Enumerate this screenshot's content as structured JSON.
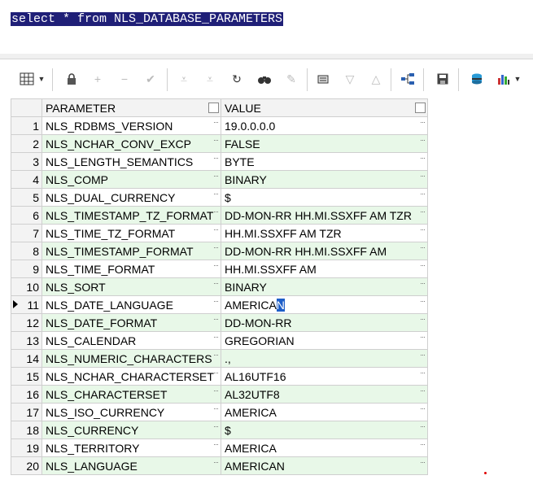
{
  "editor": {
    "sql_text": "select * from NLS_DATABASE_PARAMETERS"
  },
  "toolbar": {
    "icons": [
      "grid-view-icon",
      "dropdown-icon",
      "lock-icon",
      "add-icon",
      "remove-icon",
      "apply-icon",
      "first-icon",
      "last-icon",
      "refresh-icon",
      "search-icon",
      "clear-icon",
      "export-icon",
      "down-icon",
      "up-icon",
      "tree-icon",
      "save-icon",
      "db-icon",
      "chart-icon"
    ]
  },
  "grid": {
    "headers": [
      "PARAMETER",
      "VALUE"
    ],
    "rows": [
      {
        "n": "1",
        "param": "NLS_RDBMS_VERSION",
        "value": "19.0.0.0.0"
      },
      {
        "n": "2",
        "param": "NLS_NCHAR_CONV_EXCP",
        "value": "FALSE"
      },
      {
        "n": "3",
        "param": "NLS_LENGTH_SEMANTICS",
        "value": "BYTE"
      },
      {
        "n": "4",
        "param": "NLS_COMP",
        "value": "BINARY"
      },
      {
        "n": "5",
        "param": "NLS_DUAL_CURRENCY",
        "value": "$"
      },
      {
        "n": "6",
        "param": "NLS_TIMESTAMP_TZ_FORMAT",
        "value": "DD-MON-RR HH.MI.SSXFF AM TZR"
      },
      {
        "n": "7",
        "param": "NLS_TIME_TZ_FORMAT",
        "value": "HH.MI.SSXFF AM TZR"
      },
      {
        "n": "8",
        "param": "NLS_TIMESTAMP_FORMAT",
        "value": "DD-MON-RR HH.MI.SSXFF AM"
      },
      {
        "n": "9",
        "param": "NLS_TIME_FORMAT",
        "value": "HH.MI.SSXFF AM"
      },
      {
        "n": "10",
        "param": "NLS_SORT",
        "value": "BINARY"
      },
      {
        "n": "11",
        "param": "NLS_DATE_LANGUAGE",
        "value": "AMERICA",
        "value_sel": "N"
      },
      {
        "n": "12",
        "param": "NLS_DATE_FORMAT",
        "value": "DD-MON-RR"
      },
      {
        "n": "13",
        "param": "NLS_CALENDAR",
        "value": "GREGORIAN"
      },
      {
        "n": "14",
        "param": "NLS_NUMERIC_CHARACTERS",
        "value": ".,"
      },
      {
        "n": "15",
        "param": "NLS_NCHAR_CHARACTERSET",
        "value": "AL16UTF16"
      },
      {
        "n": "16",
        "param": "NLS_CHARACTERSET",
        "value": "AL32UTF8"
      },
      {
        "n": "17",
        "param": "NLS_ISO_CURRENCY",
        "value": "AMERICA"
      },
      {
        "n": "18",
        "param": "NLS_CURRENCY",
        "value": "$"
      },
      {
        "n": "19",
        "param": "NLS_TERRITORY",
        "value": "AMERICA"
      },
      {
        "n": "20",
        "param": "NLS_LANGUAGE",
        "value": "AMERICAN"
      }
    ],
    "current_row": "11"
  }
}
